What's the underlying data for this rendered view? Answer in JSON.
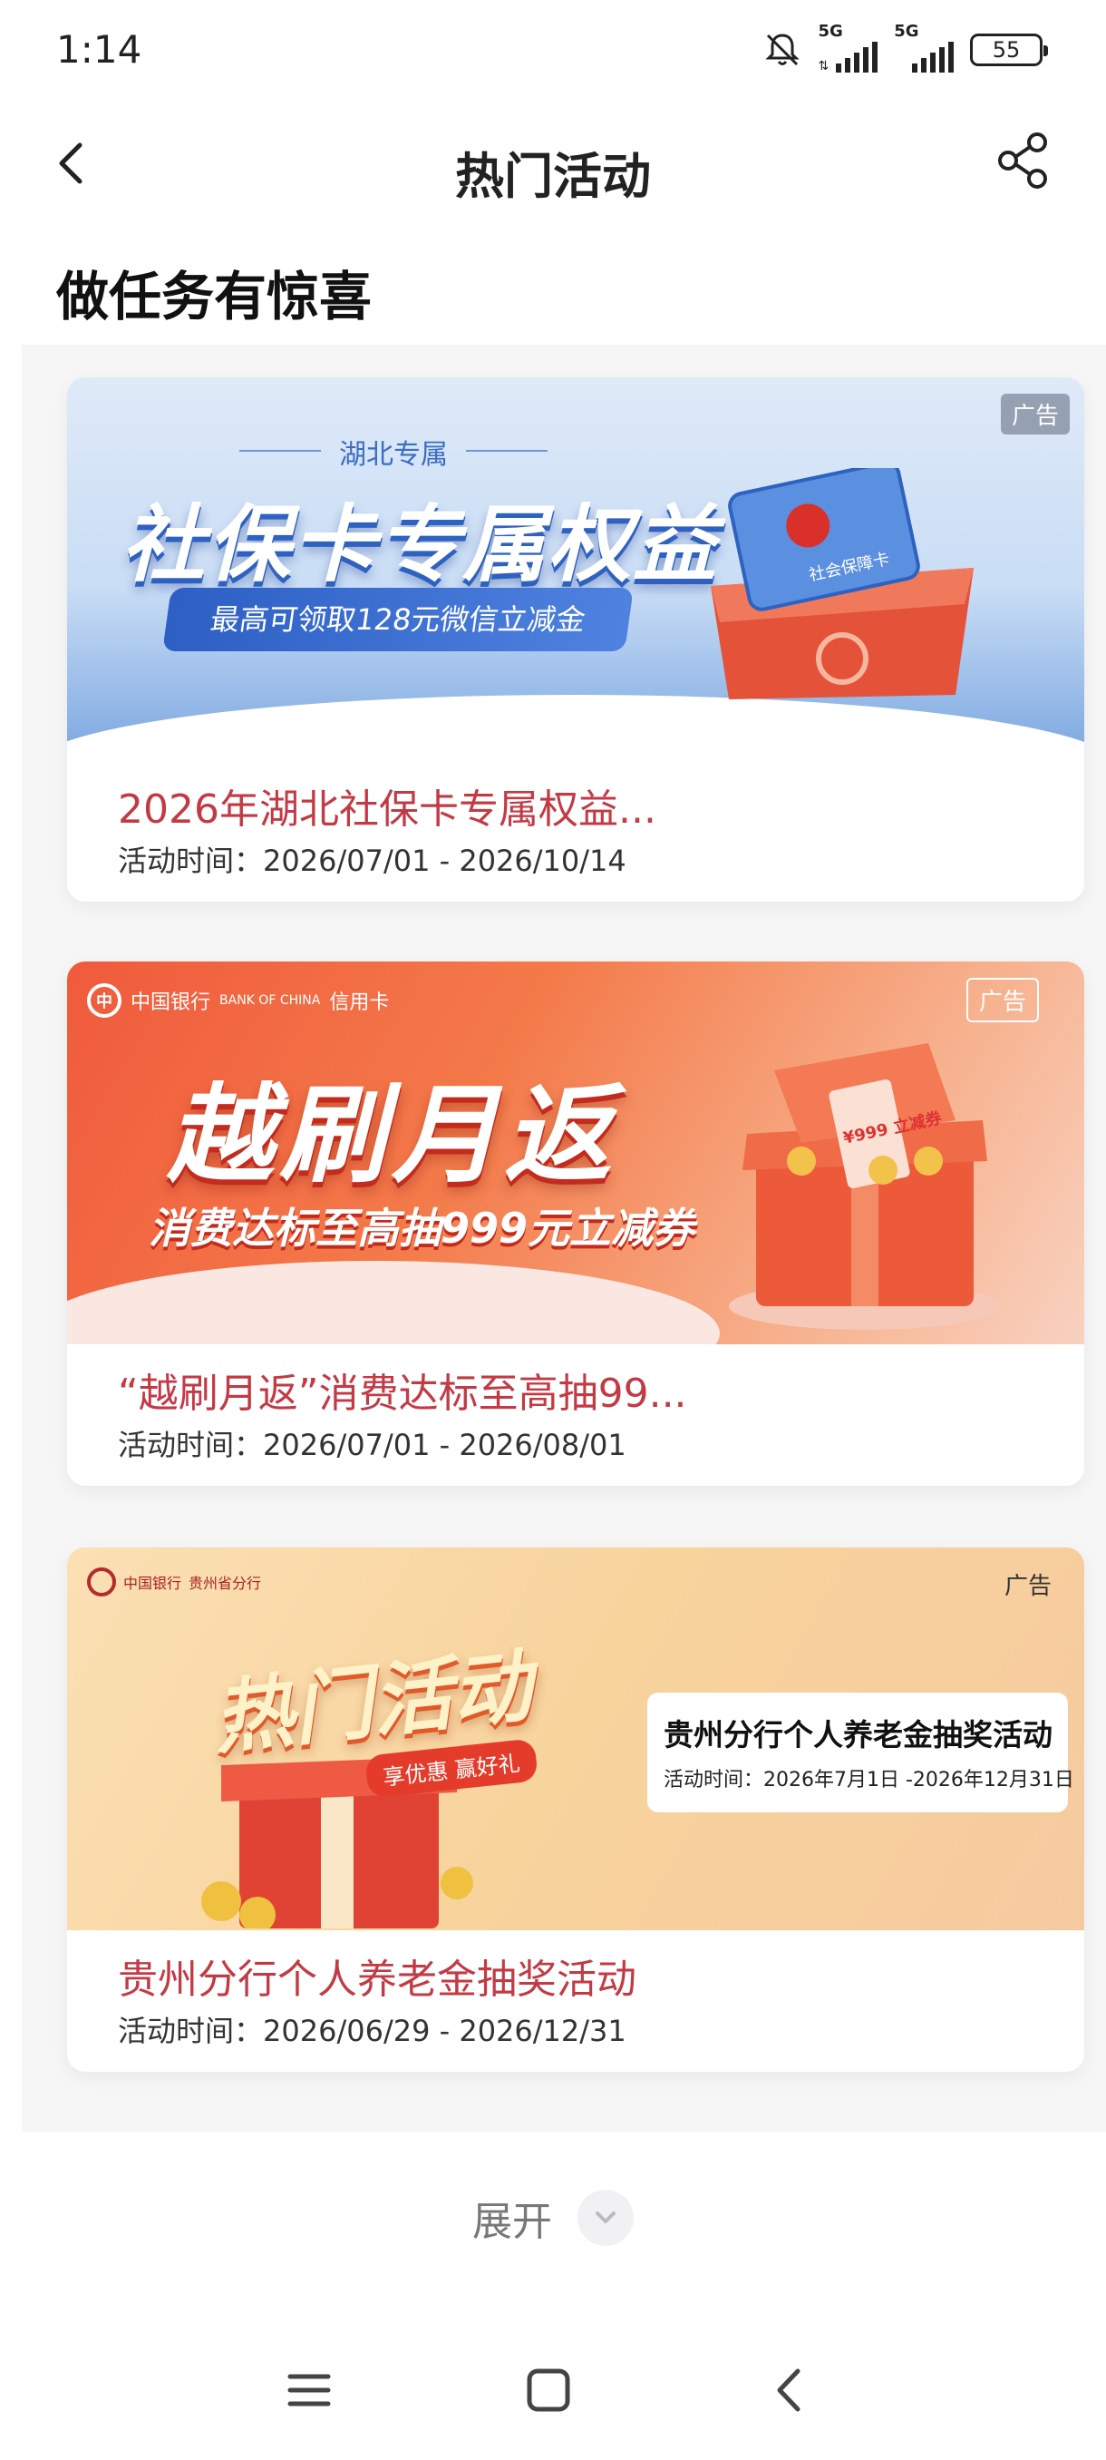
{
  "status_bar": {
    "time": "1:14",
    "network_1": "5G",
    "network_2": "5G",
    "battery": "55"
  },
  "nav": {
    "title": "热门活动"
  },
  "section": {
    "heading": "做任务有惊喜"
  },
  "cards": [
    {
      "title": "2026年湖北社保卡专属权益...",
      "date": "活动时间：2026/07/01 - 2026/10/14",
      "ad_label": "广告",
      "banner": {
        "sub": "湖北专属",
        "headline": "社保卡专属权益",
        "pill": "最高可领取128元微信立减金",
        "card_text": "社会保障卡"
      }
    },
    {
      "title": "“越刷月返”消费达标至高抽99...",
      "date": "活动时间：2026/07/01 - 2026/08/01",
      "ad_label": "广告",
      "banner": {
        "logo_cn": "中国银行",
        "logo_en": "BANK OF CHINA",
        "logo_sub": "信用卡",
        "headline": "越刷月返",
        "sub": "消费达标至高抽999元立减券",
        "ticket": "¥999 立减券"
      }
    },
    {
      "title": "贵州分行个人养老金抽奖活动",
      "date": "活动时间：2026/06/29 - 2026/12/31",
      "ad_label": "广告",
      "banner": {
        "logo_cn": "中国银行",
        "logo_sub": "贵州省分行",
        "headline": "热门活动",
        "tag": "享优惠 赢好礼",
        "info_title": "贵州分行个人养老金抽奖活动",
        "info_date": "活动时间：2026年7月1日 -2026年12月31日"
      }
    }
  ],
  "expand": {
    "label": "展开"
  },
  "colors": {
    "card_title": "#c33a45",
    "panel_bg": "#f6f6f7"
  }
}
